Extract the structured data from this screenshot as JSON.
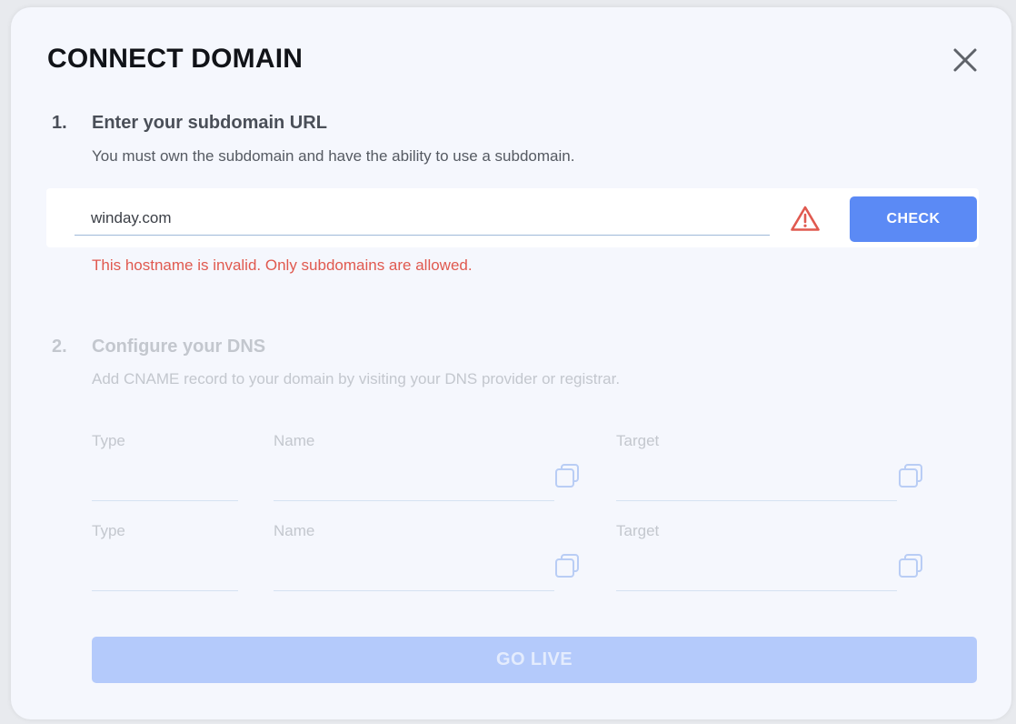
{
  "modal": {
    "title": "CONNECT DOMAIN",
    "close_icon": "close-icon"
  },
  "step1": {
    "number": "1.",
    "title": "Enter your subdomain URL",
    "description": "You must own the subdomain and have the ability to use a subdomain.",
    "input_value": "winday.com",
    "warning_icon": "warning-triangle-icon",
    "check_label": "CHECK",
    "error": "This hostname is invalid. Only subdomains are allowed."
  },
  "step2": {
    "number": "2.",
    "title": "Configure your DNS",
    "description": "Add CNAME record to your domain by visiting your DNS provider or registrar.",
    "records": [
      {
        "type_label": "Type",
        "name_label": "Name",
        "target_label": "Target"
      },
      {
        "type_label": "Type",
        "name_label": "Name",
        "target_label": "Target"
      }
    ],
    "copy_icon": "copy-icon"
  },
  "go_live_label": "GO LIVE",
  "colors": {
    "primary": "#5b8af5",
    "primary_disabled": "#b4cafb",
    "error": "#e0594f",
    "background": "#f5f7fd"
  }
}
